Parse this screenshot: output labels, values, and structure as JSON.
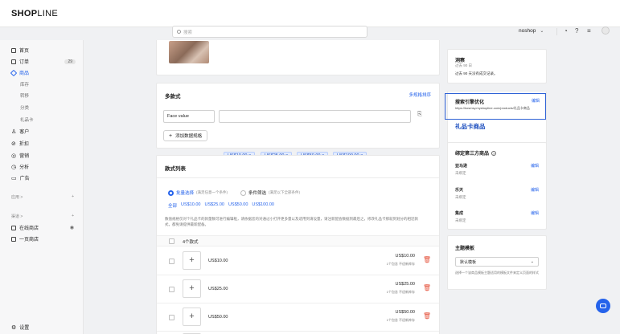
{
  "header": {
    "logo_bold": "SH",
    "logo_mid": "O",
    "logo_end": "P",
    "logo_light": "LINE",
    "search_placeholder": "搜索",
    "store_name": "noshop"
  },
  "sidebar": {
    "items": [
      {
        "label": "首页"
      },
      {
        "label": "订单",
        "badge": "29"
      },
      {
        "label": "商品"
      },
      {
        "label": "库存"
      },
      {
        "label": "转移"
      },
      {
        "label": "分类"
      },
      {
        "label": "礼品卡"
      },
      {
        "label": "客户"
      },
      {
        "label": "折扣"
      },
      {
        "label": "营销"
      },
      {
        "label": "分析"
      },
      {
        "label": "广告"
      }
    ],
    "section_apps": "应用 >",
    "section_channels": "渠道 >",
    "channels": [
      {
        "label": "在线商店"
      },
      {
        "label": "一页商店"
      }
    ],
    "settings": "设置"
  },
  "variants_card": {
    "title": "多款式",
    "sort_link": "多规格排序",
    "option_name": "Face value",
    "tags": [
      "US$10.00",
      "US$25.00",
      "US$50.00",
      "US$100.00"
    ],
    "add_button": "添加数据规格"
  },
  "variant_list": {
    "title": "款式列表",
    "radio_all": "批量选择",
    "radio_all_hint": "(满足任意一个条件)",
    "radio_cond": "条件筛选",
    "radio_cond_hint": "(满足以下全部条件)",
    "filter_all": "全部",
    "filters": [
      "US$10.00",
      "US$25.00",
      "US$50.00",
      "US$100.00"
    ],
    "notice": "数值规格仅对个礼品卡的款量数可进行编辑框，请依据您的对通过小打开更多量以及适用到请设量，请注新配会数据到最后之，修改礼品卡那就到划分的相近款式，都免请提供最新配备。",
    "count_label": "4个款式",
    "rows": [
      {
        "name": "US$10.00",
        "price": "US$10.00",
        "note": "1个包含 不适新库存"
      },
      {
        "name": "US$25.00",
        "price": "US$25.00",
        "note": "1个包含 不适新库存"
      },
      {
        "name": "US$50.00",
        "price": "US$50.00",
        "note": "1个包含 不适新库存"
      }
    ]
  },
  "right": {
    "insights_title": "洞察",
    "insights_sub": "过去 90 日",
    "insights_text": "过去 90 天没有成交记录。",
    "seo_title": "搜索引擎优化",
    "seo_edit": "编辑",
    "seo_url": "https://kosmsy.myshopline.com/products/礼品卡商品",
    "seo_page_title": "礼品卡商品",
    "third_party_title": "绑定第三方商品",
    "bindings": [
      {
        "name": "亚马逊",
        "action": "编辑",
        "status": "未绑定"
      },
      {
        "name": "乐天",
        "action": "编辑",
        "status": "未绑定"
      },
      {
        "name": "集成",
        "action": "编辑",
        "status": "未绑定"
      }
    ],
    "theme_title": "主题模板",
    "theme_select": "默认模板",
    "theme_hint": "选择一个该商品模板主题适用的模板文件来定义页面的样式"
  },
  "colors": {
    "accent": "#2563eb",
    "seo_border": "#2f62d6",
    "delete": "#e5533d"
  }
}
